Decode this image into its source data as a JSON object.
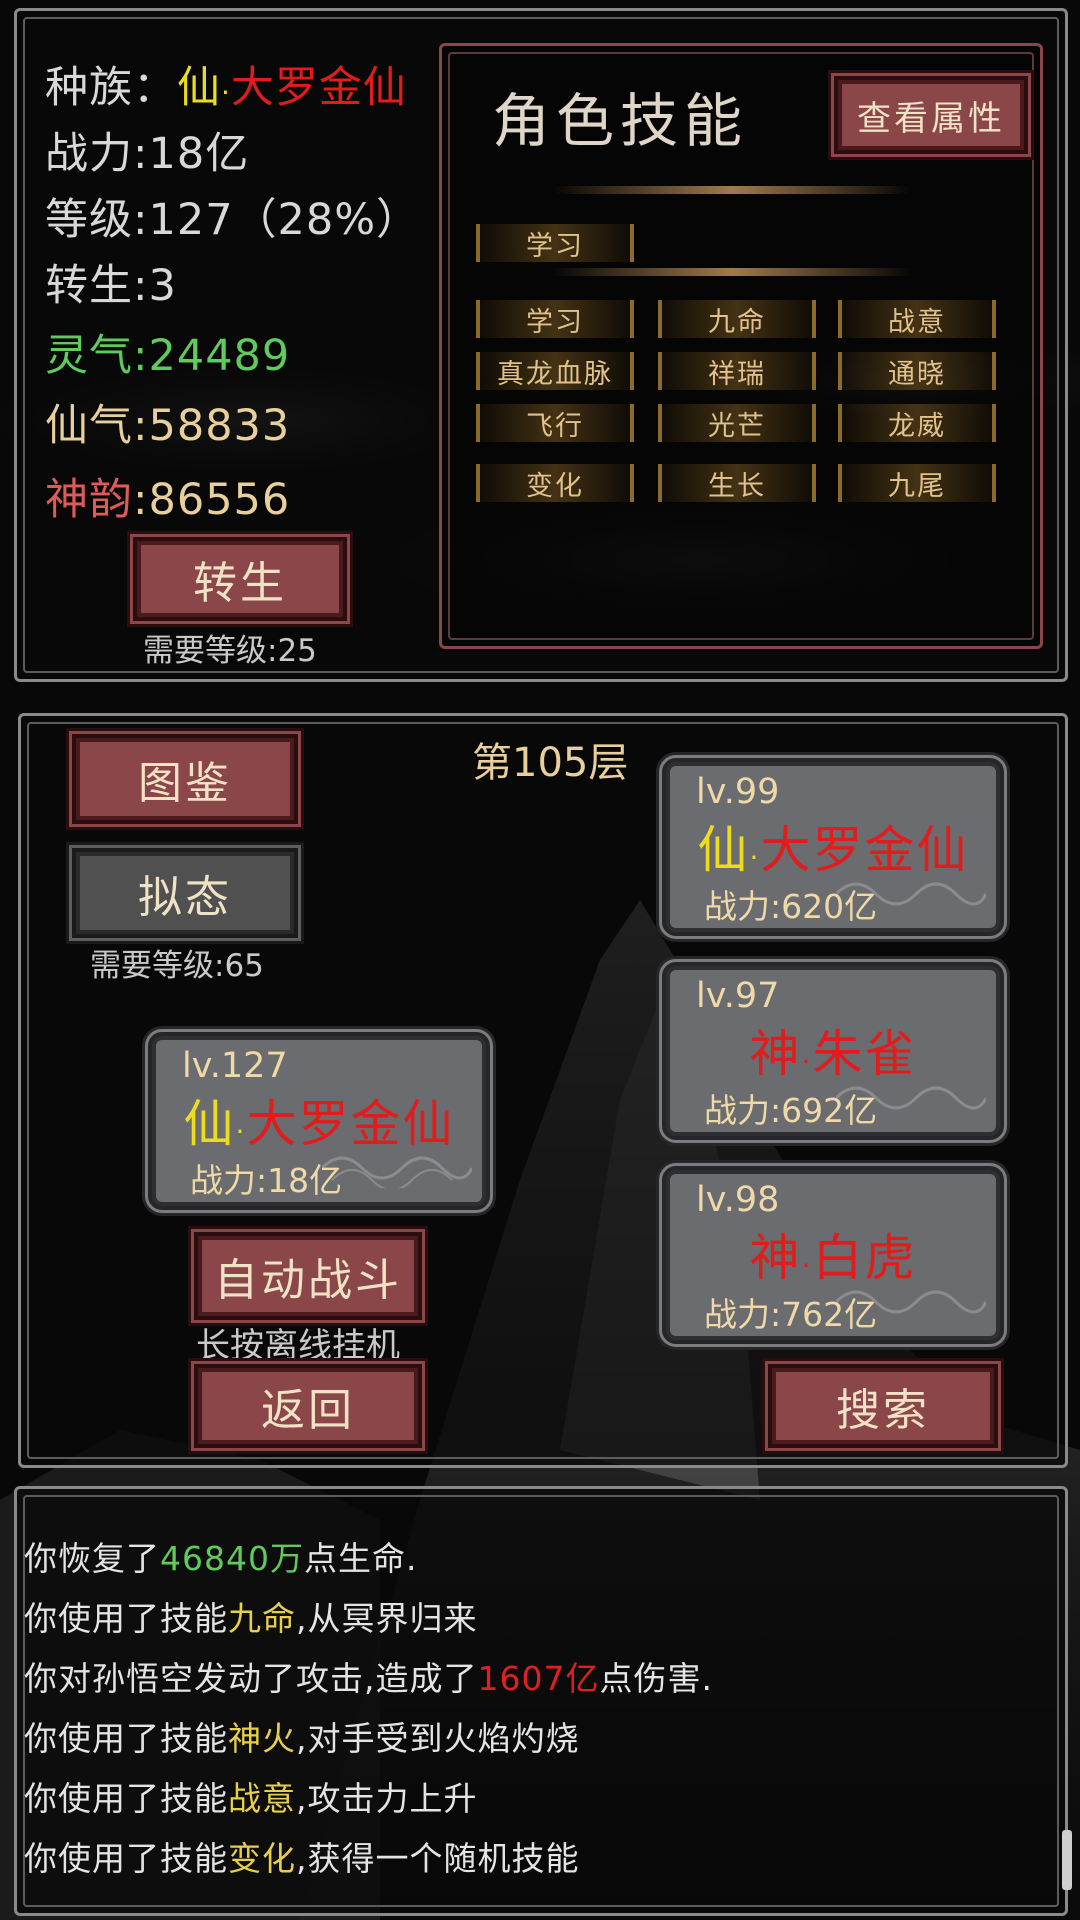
{
  "stats": {
    "race_label": "种族：",
    "race_prefix": "仙",
    "race_sep": "·",
    "race_name": "大罗金仙",
    "power": "战力:18亿",
    "level": "等级:127（28%）",
    "rebirth": "转生:3",
    "lingqi_label": "灵气",
    "lingqi_value": ":24489",
    "xianqi_label": "仙气",
    "xianqi_value": ":58833",
    "shenyun_label": "神韵",
    "shenyun_value": ":86556",
    "rebirth_button": "转生",
    "rebirth_requirement": "需要等级:25"
  },
  "skills_panel": {
    "title": "角色技能",
    "view_attributes_button": "查看属性",
    "active_skills": [
      "学习"
    ],
    "skills": [
      "学习",
      "九命",
      "战意",
      "真龙血脉",
      "祥瑞",
      "通晓",
      "飞行",
      "光芒",
      "龙威",
      "变化",
      "生长",
      "九尾"
    ]
  },
  "battle": {
    "floor": "第105层",
    "atlas_button": "图鉴",
    "mimic_button": "拟态",
    "mimic_requirement": "需要等级:65",
    "auto_battle_button": "自动战斗",
    "auto_battle_hint": "长按离线挂机",
    "back_button": "返回",
    "search_button": "搜索",
    "player": {
      "level": "lv.127",
      "prefix": "仙",
      "sep": "·",
      "name": "大罗金仙",
      "power": "战力:18亿"
    },
    "enemies": [
      {
        "level": "lv.99",
        "prefix": "仙",
        "sep": "·",
        "name": "大罗金仙",
        "power": "战力:620亿"
      },
      {
        "level": "lv.97",
        "prefix": "神",
        "sep": "·",
        "name": "朱雀",
        "power": "战力:692亿"
      },
      {
        "level": "lv.98",
        "prefix": "神",
        "sep": "·",
        "name": "白虎",
        "power": "战力:762亿"
      }
    ]
  },
  "log": [
    {
      "pre": "你恢复了",
      "hl": "46840万",
      "post": "点生命.",
      "hl_color": "#5ecb5a"
    },
    {
      "pre": "你使用了技能",
      "hl": "九命",
      "post": ",从冥界归来",
      "hl_color": "#e8cf4a"
    },
    {
      "pre": "你对孙悟空发动了攻击,造成了",
      "hl": "1607亿",
      "post": "点伤害.",
      "hl_color": "#e02020"
    },
    {
      "pre": "你使用了技能",
      "hl": "神火",
      "post": ",对手受到火焰灼烧",
      "hl_color": "#e8cf4a"
    },
    {
      "pre": "你使用了技能",
      "hl": "战意",
      "post": ",攻击力上升",
      "hl_color": "#e8cf4a"
    },
    {
      "pre": "你使用了技能",
      "hl": "变化",
      "post": ",获得一个随机技能",
      "hl_color": "#e8cf4a"
    }
  ],
  "colors": {
    "accent_red_button": "#8a4649",
    "card_gray": "#6a6c70",
    "name_red": "#e01c1c",
    "prefix_yellow": "#ecdc20"
  }
}
